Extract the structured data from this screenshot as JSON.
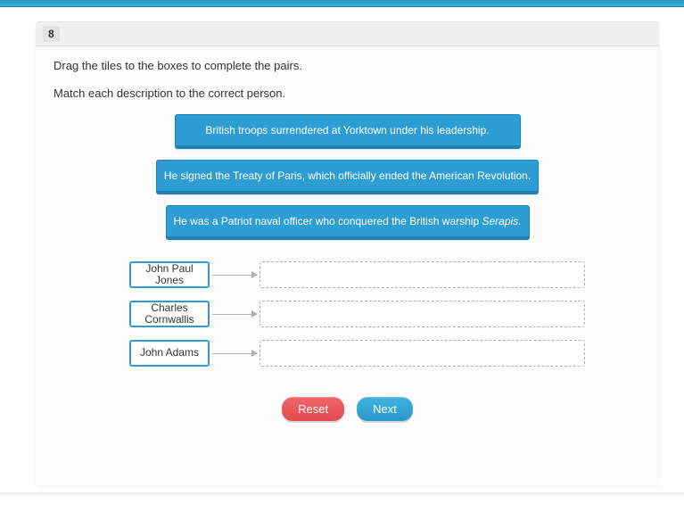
{
  "question_number": "8",
  "instructions": {
    "line1": "Drag the tiles to the boxes to complete the pairs.",
    "line2": "Match each description to the correct person."
  },
  "tiles": [
    {
      "text": "British troops surrendered at Yorktown under his leadership."
    },
    {
      "text": "He signed the Treaty of Paris, which officially ended the American Revolution."
    },
    {
      "text_prefix": "He was a Patriot naval officer who conquered the British warship ",
      "text_italic": "Serapis",
      "text_suffix": "."
    }
  ],
  "people": [
    {
      "name": "John Paul Jones"
    },
    {
      "name": "Charles Cornwallis"
    },
    {
      "name": "John Adams"
    }
  ],
  "controls": {
    "reset_label": "Reset",
    "next_label": "Next"
  }
}
